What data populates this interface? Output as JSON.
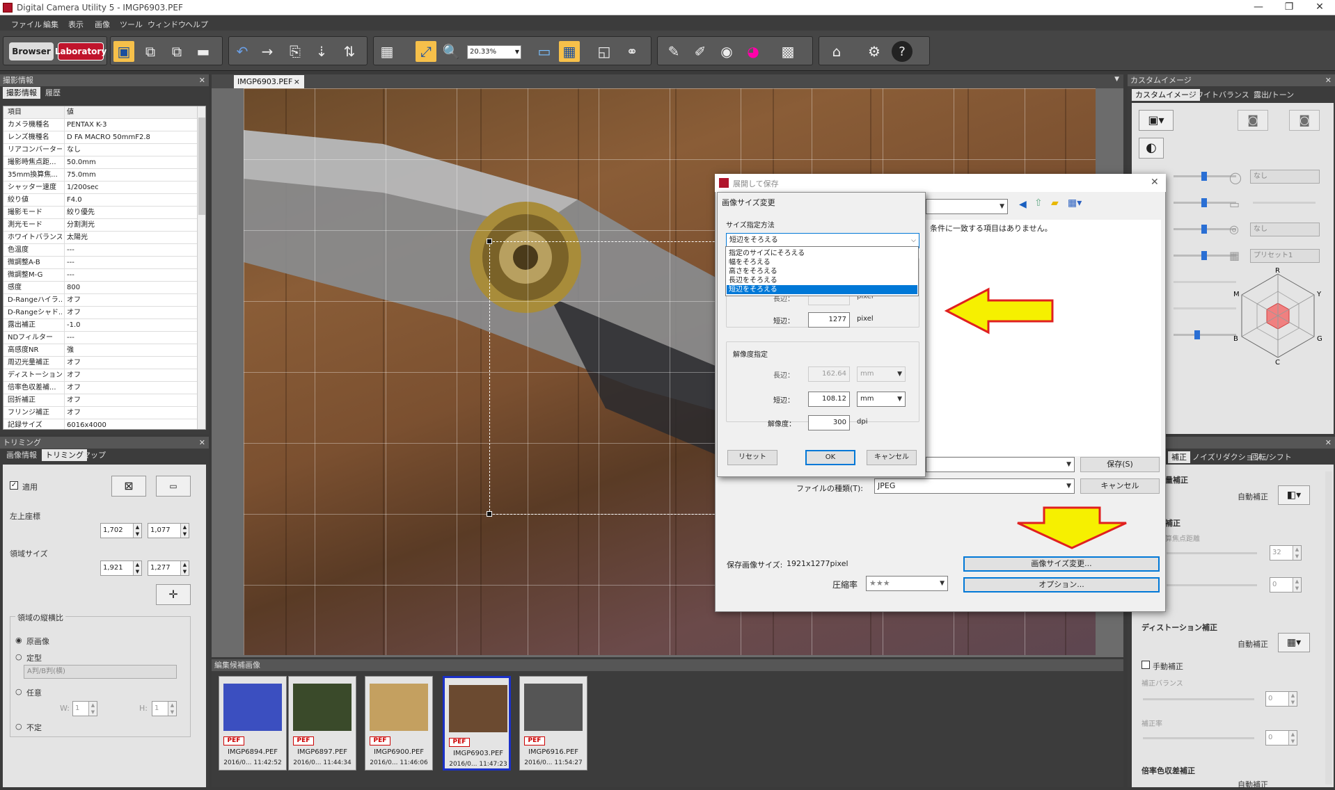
{
  "window": {
    "title": "Digital Camera Utility 5 - IMGP6903.PEF",
    "controls": [
      "—",
      "❐",
      "✕"
    ]
  },
  "menu": [
    "ファイル",
    "編集",
    "表示",
    "画像",
    "ツール",
    "ウィンドウ",
    "ヘルプ"
  ],
  "toolbar": {
    "browser_label": "Browser",
    "laboratory_label": "Laboratory",
    "zoom_value": "20.33%"
  },
  "left_top": {
    "header": "撮影情報",
    "tabs": [
      "撮影情報",
      "履歴"
    ],
    "col_key": "項目",
    "col_value": "値",
    "rows": [
      {
        "k": "カメラ機種名",
        "v": "PENTAX K-3"
      },
      {
        "k": "レンズ機種名",
        "v": "D FA MACRO 50mmF2.8"
      },
      {
        "k": "リアコンバーター",
        "v": "なし"
      },
      {
        "k": "撮影時焦点距...",
        "v": "50.0mm"
      },
      {
        "k": "35mm換算焦...",
        "v": "75.0mm"
      },
      {
        "k": "シャッター速度",
        "v": "1/200sec"
      },
      {
        "k": "絞り値",
        "v": "F4.0"
      },
      {
        "k": "撮影モード",
        "v": "絞り優先"
      },
      {
        "k": "測光モード",
        "v": "分割測光"
      },
      {
        "k": "ホワイトバランス",
        "v": "太陽光"
      },
      {
        "k": "色温度",
        "v": "---"
      },
      {
        "k": "微調整A-B",
        "v": "---"
      },
      {
        "k": "微調整M-G",
        "v": "---"
      },
      {
        "k": "感度",
        "v": "800"
      },
      {
        "k": "D-Rangeハイラ...",
        "v": "オフ"
      },
      {
        "k": "D-Rangeシャド...",
        "v": "オフ"
      },
      {
        "k": "露出補正",
        "v": "-1.0"
      },
      {
        "k": "NDフィルター",
        "v": "---"
      },
      {
        "k": "高感度NR",
        "v": "強"
      },
      {
        "k": "周辺光量補正",
        "v": "オフ"
      },
      {
        "k": "ディストーション...",
        "v": "オフ"
      },
      {
        "k": "倍率色収差補...",
        "v": "オフ"
      },
      {
        "k": "回折補正",
        "v": "オフ"
      },
      {
        "k": "フリンジ補正",
        "v": "オフ"
      },
      {
        "k": "記録サイズ",
        "v": "6016x4000"
      }
    ]
  },
  "trim": {
    "header": "トリミング",
    "tabs": [
      "画像情報",
      "トリミング",
      "マップ"
    ],
    "apply_label": "適用",
    "topleft_label": "左上座標",
    "x": "1,702",
    "y": "1,077",
    "size_label": "領域サイズ",
    "w": "1,921",
    "h": "1,277",
    "aspect_label": "領域の縦横比",
    "radio_original": "原画像",
    "radio_fixed": "定型",
    "fixed_select": "A判/B判(横)",
    "radio_any": "任意",
    "w_label": "W:",
    "w_value": "1",
    "h_label": "H:",
    "h_value": "1",
    "radio_free": "不定"
  },
  "center": {
    "tab_name": "IMGP6903.PEF",
    "tab_close": "×"
  },
  "filmstrip": {
    "header": "編集候補画像",
    "items": [
      {
        "name": "IMGP6894.PEF",
        "date": "2016/0... 11:42:52",
        "badge": "PEF",
        "color": "#3b4fc0"
      },
      {
        "name": "IMGP6897.PEF",
        "date": "2016/0... 11:44:34",
        "badge": "PEF",
        "color": "#3a4a2a"
      },
      {
        "name": "IMGP6900.PEF",
        "date": "2016/0... 11:46:06",
        "badge": "PEF",
        "color": "#c4a060"
      },
      {
        "name": "IMGP6903.PEF",
        "date": "2016/0... 11:47:23",
        "badge": "PEF",
        "color": "#6b4a30"
      },
      {
        "name": "IMGP6916.PEF",
        "date": "2016/0... 11:54:27",
        "badge": "PEF",
        "color": "#555555"
      }
    ]
  },
  "right_top": {
    "header": "カスタムイメージ",
    "tabs": [
      "カスタムイメージ",
      "ホワイトバランス",
      "露出/トーン"
    ],
    "dd1": "なし",
    "dd2": "なし",
    "dd3": "プリセット1",
    "radar": [
      "R",
      "Y",
      "G",
      "C",
      "B",
      "M"
    ]
  },
  "right_bot": {
    "tabs_visible": [
      "補正",
      "ノイズリダクション",
      "回転/シフト"
    ],
    "peripheral_label": "量補正",
    "auto1": "自動補正",
    "lens_corr": "補正",
    "focal_label": "算焦点距離",
    "focal_value": "32",
    "zero1": "0",
    "distortion_label": "ディストーション補正",
    "auto2": "自動補正",
    "manual_label": "手動補正",
    "balance_label": "補正バランス",
    "zero2": "0",
    "rate_label": "補正率",
    "zero3": "0",
    "chroma_label": "倍率色収差補正",
    "auto3": "自動補正"
  },
  "save_dialog": {
    "title": "展開して保存",
    "message": "条件に一致する項目はありません。",
    "save_button": "保存(S)",
    "cancel_button": "キャンセル",
    "filetype_label": "ファイルの種類(T):",
    "filetype_value": "JPEG",
    "save_size_label": "保存画像サイズ:",
    "save_size_value": "1921x1277pixel",
    "compression_label": "圧縮率",
    "compression_value": "★★★",
    "resize_button": "画像サイズ変更...",
    "options_button": "オプション..."
  },
  "resize_dialog": {
    "title": "画像サイズ変更",
    "method_label": "サイズ指定方法",
    "method_value": "短辺をそろえる",
    "options": [
      "指定のサイズにそろえる",
      "幅をそろえる",
      "高さをそろえる",
      "長辺をそろえる",
      "短辺をそろえる"
    ],
    "long_label": "長辺：",
    "long_unit": "pixel",
    "short_label": "短辺：",
    "short_value": "1277",
    "short_unit": "pixel",
    "res_group": "解像度指定",
    "res_long_label": "長辺：",
    "res_long_value": "162.64",
    "res_long_unit": "mm",
    "res_short_label": "短辺：",
    "res_short_value": "108.12",
    "res_short_unit": "mm",
    "dpi_label": "解像度：",
    "dpi_value": "300",
    "dpi_unit": "dpi",
    "reset": "リセット",
    "ok": "OK",
    "cancel": "キャンセル"
  },
  "accent": {
    "arrow_yellow": "#f6f000",
    "arrow_red": "#e02020",
    "selection_blue": "#1a30c8"
  }
}
